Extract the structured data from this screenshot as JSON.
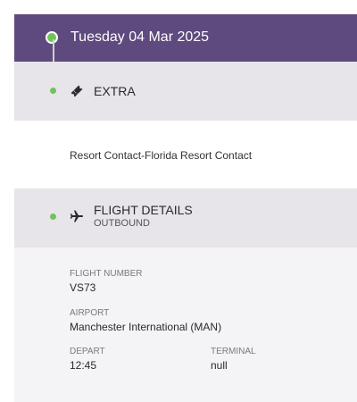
{
  "header": {
    "date": "Tuesday 04 Mar 2025"
  },
  "extra": {
    "title": "EXTRA",
    "icon": "ticket-icon",
    "description": "Resort Contact-Florida Resort Contact"
  },
  "flight": {
    "title": "FLIGHT DETAILS",
    "subtitle": "OUTBOUND",
    "icon": "airplane-icon",
    "flight_number_label": "FLIGHT NUMBER",
    "flight_number": "VS73",
    "airport_label": "AIRPORT",
    "airport": "Manchester International (MAN)",
    "depart_label": "DEPART",
    "depart": "12:45",
    "terminal_label": "TERMINAL",
    "terminal": "null"
  },
  "colors": {
    "header_bg": "#5e4a7e",
    "accent_green": "#6fc35b",
    "band_bg": "#e7e4ea"
  }
}
